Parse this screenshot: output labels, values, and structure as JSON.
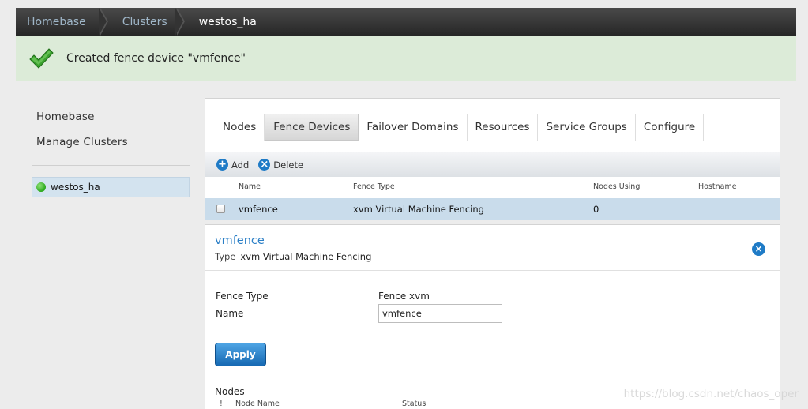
{
  "breadcrumb": {
    "items": [
      "Homebase",
      "Clusters",
      "westos_ha"
    ]
  },
  "notification": {
    "message": "Created fence device \"vmfence\""
  },
  "sidebar": {
    "links": [
      "Homebase",
      "Manage Clusters"
    ],
    "cluster": {
      "name": "westos_ha",
      "status_color": "#2aa81b"
    }
  },
  "tabs": [
    "Nodes",
    "Fence Devices",
    "Failover Domains",
    "Resources",
    "Service Groups",
    "Configure"
  ],
  "active_tab": "Fence Devices",
  "toolbar": {
    "add_label": "Add",
    "delete_label": "Delete"
  },
  "table": {
    "columns": [
      "Name",
      "Fence Type",
      "Nodes Using",
      "Hostname"
    ],
    "rows": [
      {
        "name": "vmfence",
        "fence_type": "xvm Virtual Machine Fencing",
        "nodes_using": "0",
        "hostname": ""
      }
    ]
  },
  "detail": {
    "title": "vmfence",
    "type_label": "Type",
    "type_value": "xvm Virtual Machine Fencing",
    "fence_type_label": "Fence Type",
    "fence_type_value": "Fence xvm",
    "name_label": "Name",
    "name_value": "vmfence",
    "apply_label": "Apply",
    "nodes_label": "Nodes",
    "nodes_columns": [
      "!",
      "Node Name",
      "Status"
    ]
  },
  "watermark": "https://blog.csdn.net/chaos_oper",
  "colors": {
    "accent": "#2b7fc6",
    "success_bg": "#dcebd8",
    "selected_row": "#c9dceb"
  }
}
